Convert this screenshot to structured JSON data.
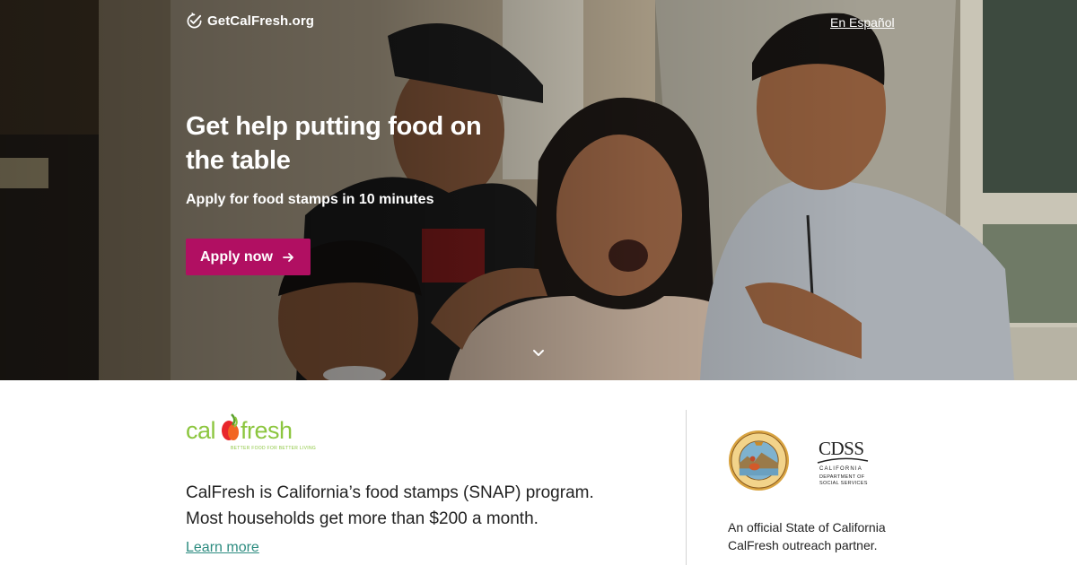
{
  "header": {
    "brand": "GetCalFresh.org",
    "brand_icon": "check-badge-icon",
    "language_link": "En Español"
  },
  "hero": {
    "title": "Get help putting food on the table",
    "subtitle": "Apply for food stamps in 10 minutes",
    "cta_label": "Apply now",
    "cta_icon": "arrow-right-icon",
    "cta_color": "#b10f62",
    "scroll_icon": "chevron-down-icon",
    "background_image": "family-photo"
  },
  "info": {
    "logo_wordmark_left": "cal",
    "logo_wordmark_right": "fresh",
    "logo_tagline": "BETTER FOOD FOR BETTER LIVING",
    "description_line1": "CalFresh is California’s food stamps (SNAP) program.",
    "description_line2": "Most households get more than $200 a month.",
    "learn_more": "Learn more",
    "link_color": "#2d8c80",
    "seal_icon": "california-state-seal",
    "cdss_logo": {
      "abbr": "CDSS",
      "line1": "CALIFORNIA",
      "line2": "DEPARTMENT OF",
      "line3": "SOCIAL SERVICES"
    },
    "partner_text": "An official State of California CalFresh outreach partner."
  }
}
